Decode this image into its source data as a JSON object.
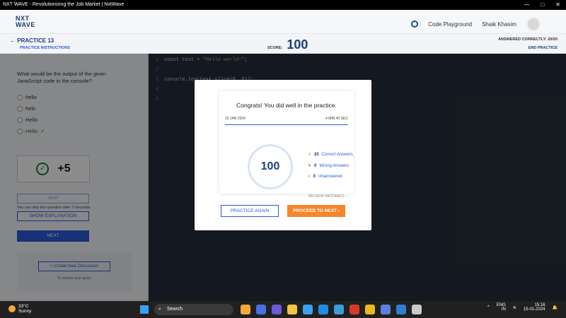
{
  "window": {
    "title": "NXT WAVE - Revolutionizing the Job Market | NxtWave"
  },
  "header": {
    "logo_line1": "NXT",
    "logo_line2": "WAVE",
    "code_playground": "Code Playground",
    "user_name": "Shaik Khasim"
  },
  "subheader": {
    "practice_title": "PRACTICE 13",
    "practice_instructions": "PRACTICE INSTRUCTIONS",
    "score_label": "SCORE:",
    "score_value": "100",
    "answered": "ANSWERED CORRECTLY: 20/20",
    "end_practice": "END PRACTICE"
  },
  "question": {
    "text": "What would be the output of the given JavaScript code in the console?",
    "options": [
      "hello",
      "helo",
      "Hello",
      "Hello"
    ],
    "points": "+5",
    "skip_label": "SKIP",
    "skip_note": "You can skip this question after 3 Seconds",
    "show_explanation": "SHOW EXPLANATION",
    "next_label": "NEXT",
    "create_discussion": "+ Create New Discussion",
    "resolve_note": "To resolve your query"
  },
  "editor": {
    "lines": [
      {
        "n": "1",
        "code": "const text = \"Hello world!\";"
      },
      {
        "n": "2",
        "code": ""
      },
      {
        "n": "3",
        "code": "console.log(text.slice(0, 5));"
      },
      {
        "n": "4",
        "code": ""
      },
      {
        "n": "5",
        "code": ""
      }
    ]
  },
  "modal": {
    "congrats": "Congrats! You did well in the practice.",
    "date": "15 JAN 2024",
    "duration": "4 MIN 40 SEC",
    "score": "100",
    "correct_count": "20",
    "correct_label": "Correct Answers",
    "wrong_count": "0",
    "wrong_label": "Wrong Answers",
    "unanswered_count": "0",
    "unanswered_label": "Unanswered",
    "review_label": "REVIEW MISTAKES",
    "practice_again": "PRACTICE AGAIN",
    "proceed_next": "PROCEED TO NEXT"
  },
  "taskbar": {
    "temp": "33°C",
    "weather": "Sunny",
    "search": "Search",
    "lang": "ENG",
    "region": "IN",
    "time": "15:16",
    "date": "15-01-2024"
  }
}
